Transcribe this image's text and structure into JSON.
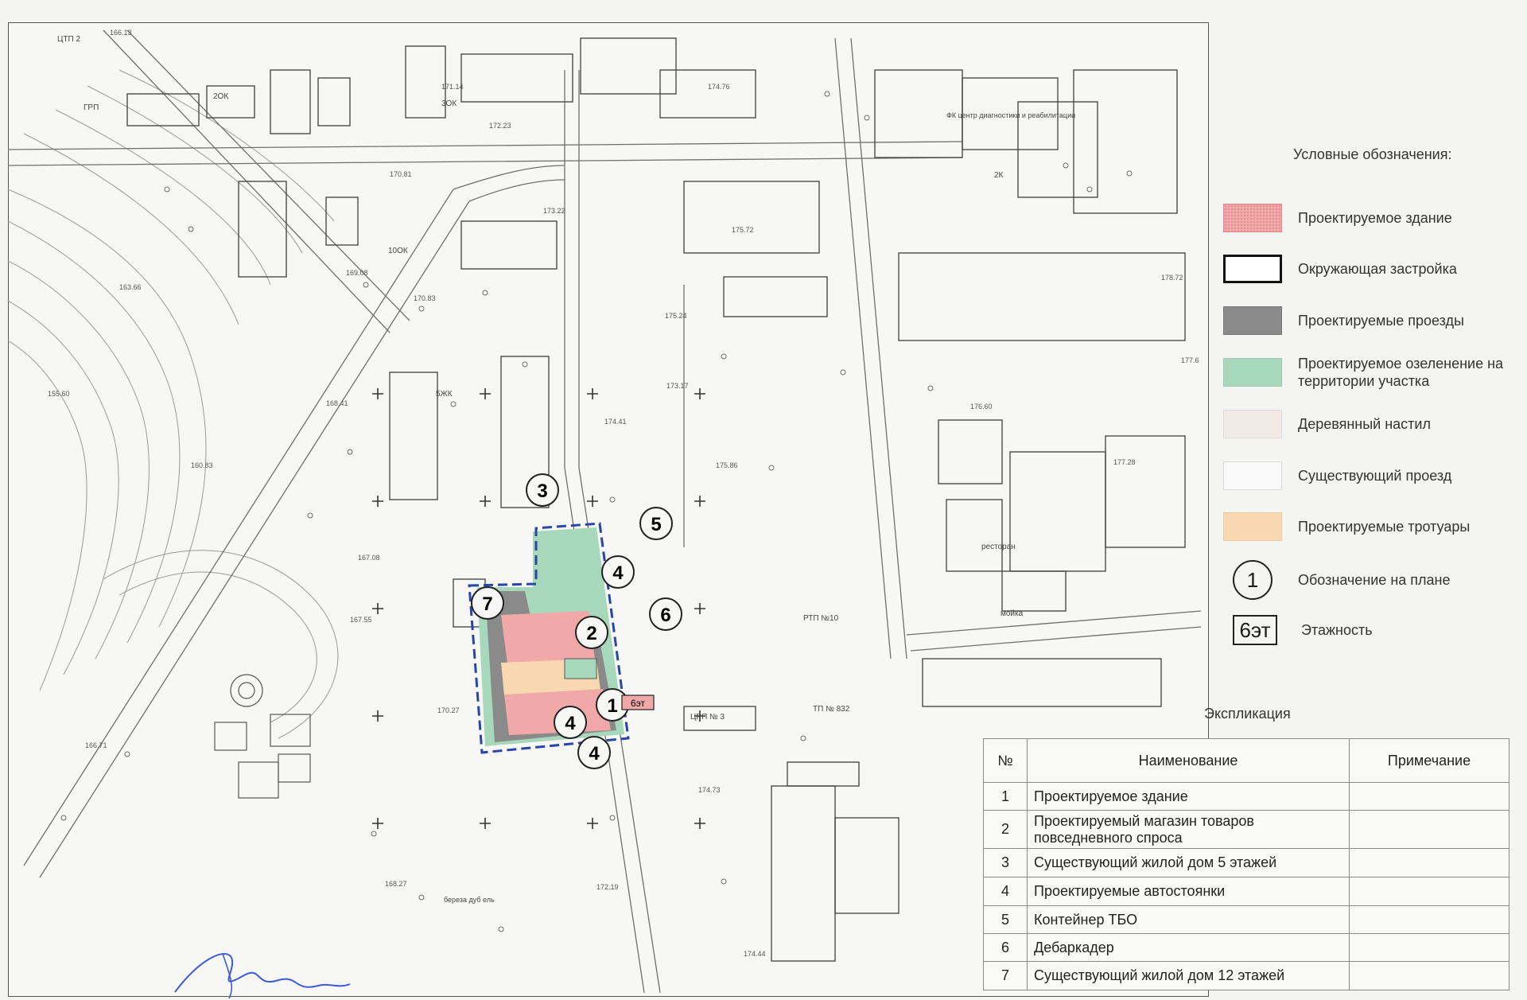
{
  "legend": {
    "title": "Условные обозначения:",
    "items": [
      {
        "label": "Проектируемое здание",
        "kind": "swatch",
        "color": "#f0a8a8",
        "border": "#e08888"
      },
      {
        "label": "Окружающая застройка",
        "kind": "swatch",
        "color": "#ffffff",
        "border": "#111111"
      },
      {
        "label": "Проектируемые проезды",
        "kind": "swatch",
        "color": "#8a8a8a",
        "border": "#777777"
      },
      {
        "label": "Проектируемое озеленение на территории участка",
        "kind": "swatch",
        "color": "#a8d8bc",
        "border": "#9cc9b0"
      },
      {
        "label": "Деревянный настил",
        "kind": "swatch",
        "color": "#f1eae6",
        "border": "#e3d9d4"
      },
      {
        "label": "Существующий проезд",
        "kind": "swatch",
        "color": "#fafafa",
        "border": "#d8d8d8"
      },
      {
        "label": "Проектируемые тротуары",
        "kind": "swatch",
        "color": "#f8d8b0",
        "border": "#eac8a0"
      },
      {
        "label": "Обозначение на плане",
        "kind": "circle",
        "symbol": "1"
      },
      {
        "label": "Этажность",
        "kind": "box",
        "symbol": "6эт"
      }
    ]
  },
  "explication": {
    "title": "Экспликация",
    "headers": [
      "№",
      "Наименование",
      "Примечание"
    ],
    "rows": [
      {
        "num": "1",
        "name": "Проектируемое здание",
        "note": ""
      },
      {
        "num": "2",
        "name": "Проектируемый магазин товаров повседневного спроса",
        "note": ""
      },
      {
        "num": "3",
        "name": "Существующий жилой дом 5 этажей",
        "note": ""
      },
      {
        "num": "4",
        "name": "Проектируемые автостоянки",
        "note": ""
      },
      {
        "num": "5",
        "name": "Контейнер ТБО",
        "note": ""
      },
      {
        "num": "6",
        "name": "Дебаркадер",
        "note": ""
      },
      {
        "num": "7",
        "name": "Существующий жилой дом 12 этажей",
        "note": ""
      }
    ]
  },
  "map": {
    "markers": [
      "1",
      "2",
      "3",
      "4",
      "4",
      "4",
      "5",
      "6",
      "7"
    ],
    "floor_label": "6эт",
    "labels": [
      "ЦТП 2",
      "ГРП",
      "2ОК",
      "3ОК",
      "5ЖК",
      "10ОК",
      "2К",
      "ЦРП № 3",
      "РТП №10",
      "ТП № 832",
      "ресторан",
      "мойка",
      "береза дуб ель",
      "ФК центр диагностики и реабилитации"
    ],
    "elevations": [
      "166.13",
      "171.14",
      "174.76",
      "172.23",
      "170.81",
      "173.22",
      "175.72",
      "178.72",
      "175.24",
      "173.17",
      "174.41",
      "175.86",
      "176.60",
      "177.28",
      "177.6",
      "163.66",
      "155.60",
      "160.83",
      "168.41",
      "169.08",
      "170.83",
      "167.08",
      "167.55",
      "170.27",
      "166.71",
      "174.73",
      "172.19",
      "174.44",
      "168.27"
    ]
  },
  "colors": {
    "map_bg": "#f7f7f5",
    "line": "#6f6f6f",
    "site_boundary": "#2846a8",
    "building": "#f0a8a8",
    "road": "#8a8a8a",
    "green": "#a8d8bc",
    "sidewalk": "#f8d8b0"
  }
}
